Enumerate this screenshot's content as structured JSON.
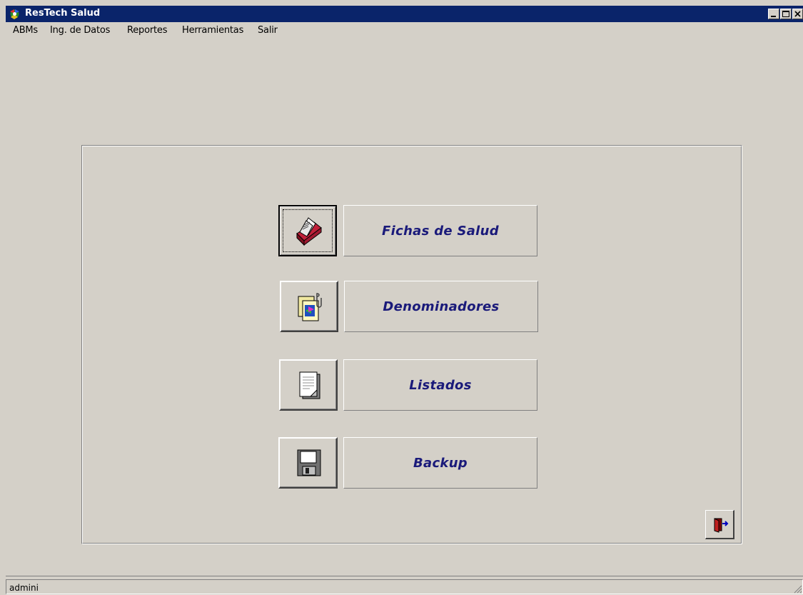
{
  "window": {
    "title": "ResTech Salud"
  },
  "menu": {
    "items": [
      {
        "label": "ABMs"
      },
      {
        "label": "Ing. de Datos"
      },
      {
        "label": "Reportes"
      },
      {
        "label": "Herramientas"
      },
      {
        "label": "Salir"
      }
    ]
  },
  "main": {
    "buttons": [
      {
        "label": "Fichas de Salud",
        "icon": "card-file-icon"
      },
      {
        "label": "Denominadores",
        "icon": "transfer-document-icon"
      },
      {
        "label": "Listados",
        "icon": "document-pages-icon"
      },
      {
        "label": "Backup",
        "icon": "floppy-disk-icon"
      }
    ],
    "exit_icon": "exit-door-icon"
  },
  "status": {
    "user": "admini"
  },
  "colors": {
    "face": "#d4d0c8",
    "titlebar": "#0a246a",
    "label_text": "#1a1a7a"
  }
}
